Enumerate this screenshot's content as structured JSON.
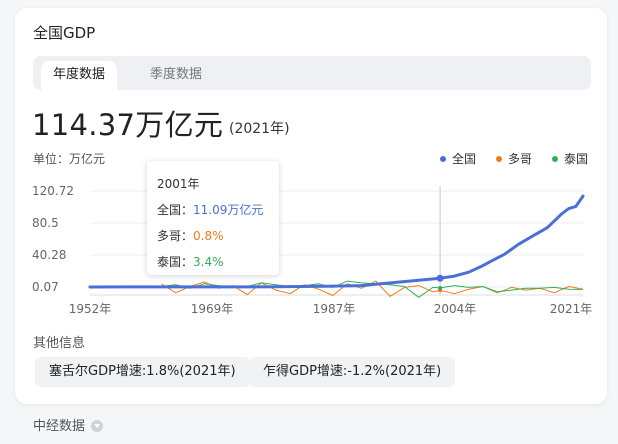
{
  "card": {
    "title": "全国GDP",
    "tabs": [
      {
        "label": "年度数据",
        "active": true
      },
      {
        "label": "季度数据",
        "active": false
      }
    ],
    "value": "114.37万亿元",
    "value_year": "(2021年)",
    "unit": "单位：万亿元"
  },
  "legend": [
    {
      "label": "全国",
      "color": "#4a6fd8"
    },
    {
      "label": "多哥",
      "color": "#f07b1b"
    },
    {
      "label": "泰国",
      "color": "#2fb05a"
    }
  ],
  "tooltip": {
    "year": "2001年",
    "rows": [
      {
        "label": "全国：",
        "value": "11.09万亿元",
        "color": "#4a6fd8"
      },
      {
        "label": "多哥：",
        "value": "0.8%",
        "color": "#f07b1b"
      },
      {
        "label": "泰国：",
        "value": "3.4%",
        "color": "#2fb05a"
      }
    ]
  },
  "chart_data": {
    "type": "line",
    "y_ticks": [
      "120.72",
      "80.5",
      "40.28",
      "0.07"
    ],
    "x_ticks": [
      "1952年",
      "1969年",
      "1987年",
      "2004年",
      "2021年"
    ],
    "ylim": [
      0.07,
      120.72
    ],
    "xlim": [
      1952,
      2021
    ],
    "series": [
      {
        "name": "全国",
        "color": "#4a6fd8",
        "x": [
          1952,
          1960,
          1970,
          1978,
          1985,
          1990,
          1995,
          1998,
          2001,
          2003,
          2005,
          2007,
          2008,
          2010,
          2012,
          2014,
          2016,
          2018,
          2019,
          2020,
          2021
        ],
        "y": [
          0.07,
          0.15,
          0.23,
          0.37,
          0.91,
          1.89,
          6.13,
          8.52,
          11.09,
          13.74,
          18.73,
          27.02,
          31.92,
          41.21,
          53.86,
          64.36,
          74.64,
          91.93,
          98.65,
          101.36,
          114.37
        ]
      },
      {
        "name": "多哥",
        "color": "#f07b1b",
        "x": [
          1962,
          1964,
          1966,
          1968,
          1970,
          1972,
          1974,
          1976,
          1978,
          1980,
          1982,
          1984,
          1986,
          1988,
          1990,
          1992,
          1994,
          1996,
          1998,
          2000,
          2001,
          2003,
          2005,
          2007,
          2009,
          2011,
          2013,
          2015,
          2017,
          2019,
          2021
        ],
        "y": [
          8,
          -2,
          5,
          10,
          3,
          6,
          -4,
          9,
          1,
          -3,
          7,
          2,
          -5,
          8,
          3,
          11,
          -6,
          4,
          6,
          -1,
          0.8,
          -3,
          2,
          5,
          -2,
          4,
          1,
          3,
          -2,
          5,
          2
        ]
      },
      {
        "name": "泰国",
        "color": "#2fb05a",
        "x": [
          1962,
          1964,
          1966,
          1968,
          1970,
          1972,
          1974,
          1976,
          1978,
          1980,
          1982,
          1984,
          1986,
          1988,
          1990,
          1992,
          1994,
          1996,
          1998,
          2000,
          2001,
          2003,
          2005,
          2007,
          2009,
          2011,
          2013,
          2015,
          2017,
          2019,
          2021
        ],
        "y": [
          5,
          7,
          3,
          8,
          6,
          4,
          5,
          9,
          7,
          5,
          6,
          8,
          4,
          11,
          9,
          8,
          7,
          5,
          -7,
          4,
          3.4,
          6,
          4,
          5,
          -1,
          1,
          3,
          3,
          4,
          2,
          1.8
        ]
      }
    ],
    "highlight": {
      "x": 2001
    }
  },
  "other_info": {
    "title": "其他信息",
    "chips": [
      "塞舌尔GDP增速:1.8%(2021年)",
      "乍得GDP增速:-1.2%(2021年)"
    ]
  },
  "footer": {
    "label": "中经数据"
  }
}
